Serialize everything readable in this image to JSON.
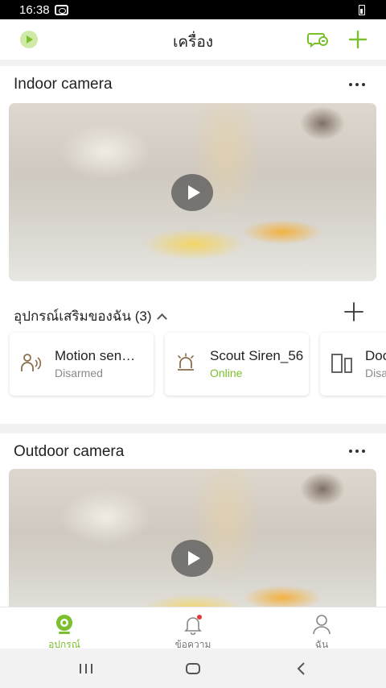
{
  "status_bar": {
    "time": "16:38"
  },
  "app_bar": {
    "title": "เครื่อง"
  },
  "cameras": [
    {
      "name": "Indoor camera"
    },
    {
      "name": "Outdoor camera"
    }
  ],
  "accessories": {
    "header": "อุปกรณ์เสริมของฉัน (3)",
    "items": [
      {
        "name": "Motion sen…",
        "status": "Disarmed"
      },
      {
        "name": "Scout Siren_56",
        "status": "Online"
      },
      {
        "name": "Doo",
        "status": "Disa"
      }
    ]
  },
  "bottom_nav": [
    {
      "label": "อุปกรณ์"
    },
    {
      "label": "ข้อความ"
    },
    {
      "label": "ฉัน"
    }
  ],
  "colors": {
    "accent": "#7bbf2e",
    "notification": "#e53935"
  }
}
